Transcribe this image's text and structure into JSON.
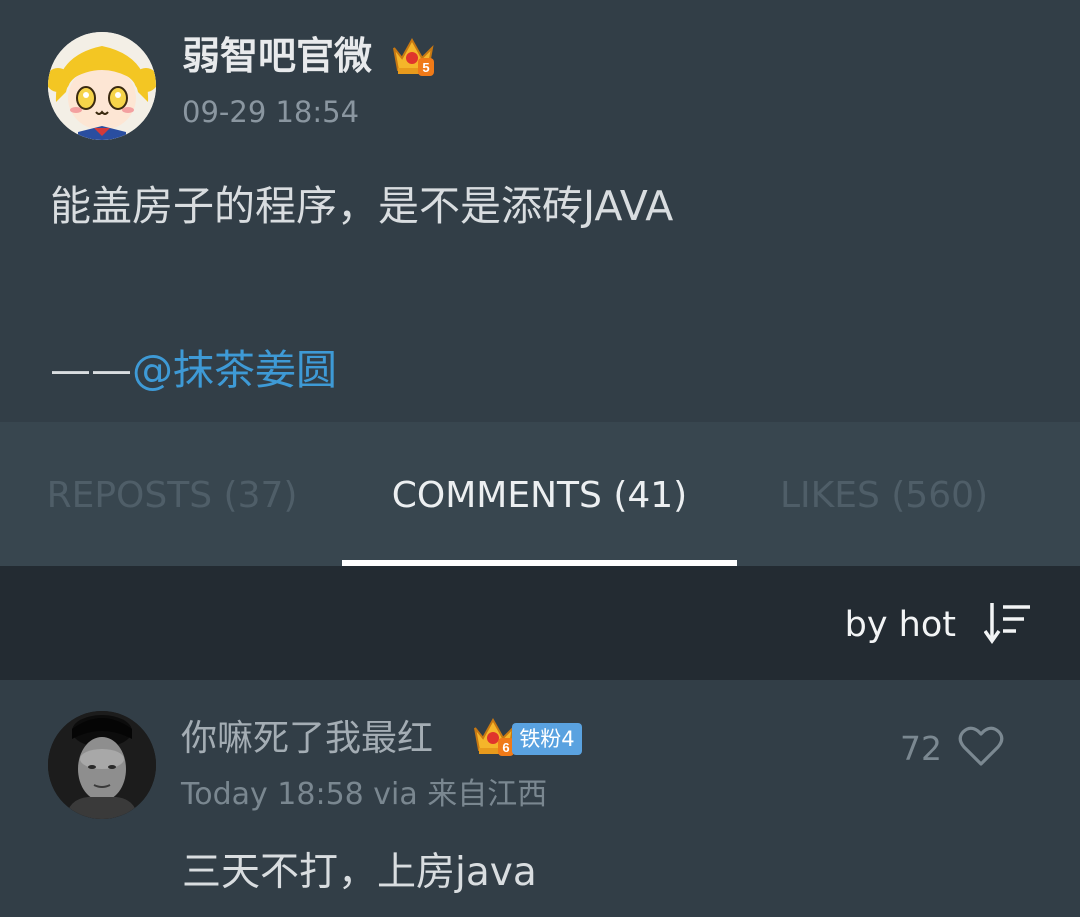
{
  "post": {
    "author": "弱智吧官微",
    "author_level": "5",
    "time": "09-29 18:54",
    "text": "能盖房子的程序，是不是添砖JAVA",
    "credit_prefix": "——",
    "credit_mention": "@抹茶姜圆"
  },
  "tabs": [
    {
      "label": "REPOSTS (37)",
      "active": false
    },
    {
      "label": "COMMENTS (41)",
      "active": true
    },
    {
      "label": "LIKES (560)",
      "active": false
    }
  ],
  "sort": {
    "label": "by hot",
    "icon": "sort-icon"
  },
  "comments": [
    {
      "author": "你嘛死了我最红",
      "level": "6",
      "fan_badge": "铁粉4",
      "time": "Today 18:58 via 来自江西",
      "likes": "72",
      "text": "三天不打，上房java"
    }
  ],
  "colors": {
    "background": "#323e47",
    "tab_bar": "#38464f",
    "sort_bar": "#232b32",
    "mention": "#3e9ad6",
    "fan_badge": "#5aa2e0"
  }
}
